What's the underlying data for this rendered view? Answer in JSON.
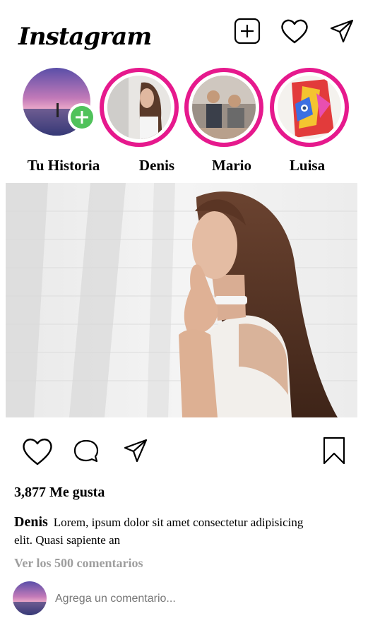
{
  "header": {
    "logo_text": "Instagram",
    "icons": [
      "new-post-icon",
      "heart-icon",
      "send-icon"
    ]
  },
  "stories": [
    {
      "label": "Tu Historia",
      "own": true
    },
    {
      "label": "Denis"
    },
    {
      "label": "Mario"
    },
    {
      "label": "Luisa"
    }
  ],
  "post": {
    "likes": "3,877 Me gusta",
    "username": "Denis",
    "caption": "Lorem, ipsum dolor sit amet consectetur adipisicing elit. Quasi sapiente an",
    "view_comments": "Ver los 500 comentarios",
    "comment_placeholder": "Agrega un comentario..."
  },
  "colors": {
    "story_ring": "#e6198d",
    "add_badge": "#50c25b",
    "muted_text": "#9e9e9e"
  }
}
